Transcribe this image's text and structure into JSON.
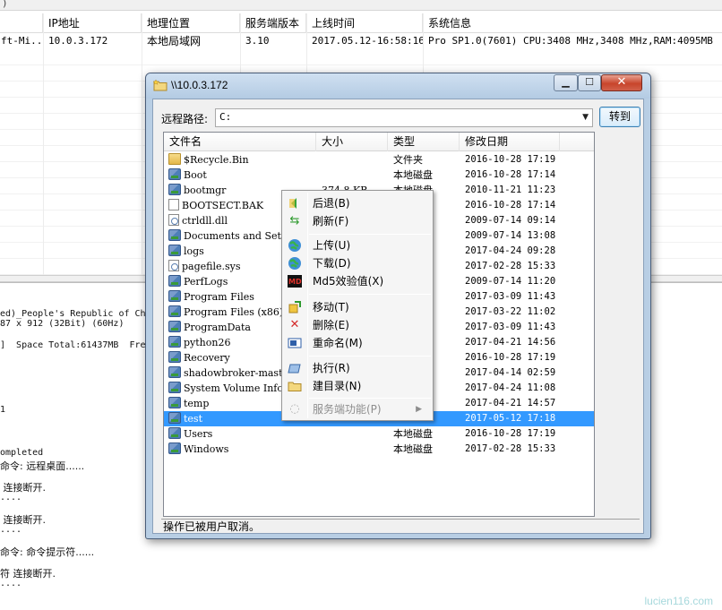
{
  "host_table": {
    "columns": [
      "",
      "IP地址",
      "地理位置",
      "服务端版本",
      "上线时间",
      "系统信息"
    ],
    "row": [
      "ft-Mi...",
      "10.0.3.172",
      "本地局域网",
      "3.10",
      "2017.05.12-16:58:16",
      "Pro SP1.0(7601) CPU:3408 MHz,3408 MHz,RAM:4095MB"
    ]
  },
  "log_lines": [
    "ed)_People's Republic of Ch",
    "87 x 912 (32Bit) (60Hz)",
    "]  Space Total:61437MB  Fre",
    "1",
    "ompleted",
    "命令: 远程桌面......",
    " 连接断开.",
    "....",
    " 连接断开.",
    "....",
    "命令: 命令提示符......",
    "符 连接断开.",
    "...."
  ],
  "dialog": {
    "title": "\\\\10.0.3.172",
    "path_label": "远程路径:",
    "path_value": "C:",
    "goto_label": "转到",
    "status": "操作已被用户取消。",
    "columns": [
      "文件名",
      "大小",
      "类型",
      "修改日期"
    ],
    "files": [
      {
        "icon": "folder",
        "name": "$Recycle.Bin",
        "size": "",
        "type": "文件夹",
        "date": "2016-10-28 17:19"
      },
      {
        "icon": "drive",
        "name": "Boot",
        "size": "",
        "type": "本地磁盘",
        "date": "2016-10-28 17:14"
      },
      {
        "icon": "drive",
        "name": "bootmgr",
        "size": "374.8 KB",
        "type": "本地磁盘",
        "date": "2010-11-21 11:23"
      },
      {
        "icon": "file",
        "name": "BOOTSECT.BAK",
        "size": "",
        "type": "",
        "date": "2016-10-28 17:14"
      },
      {
        "icon": "gear",
        "name": "ctrldll.dll",
        "size": "",
        "type": "...",
        "date": "2009-07-14 09:14"
      },
      {
        "icon": "drive",
        "name": "Documents and Setti",
        "size": "",
        "type": "",
        "date": "2009-07-14 13:08"
      },
      {
        "icon": "drive",
        "name": "logs",
        "size": "",
        "type": "",
        "date": "2017-04-24 09:28"
      },
      {
        "icon": "gear",
        "name": "pagefile.sys",
        "size": "",
        "type": "",
        "date": "2017-02-28 15:33"
      },
      {
        "icon": "drive",
        "name": "PerfLogs",
        "size": "",
        "type": "",
        "date": "2009-07-14 11:20"
      },
      {
        "icon": "drive",
        "name": "Program Files",
        "size": "",
        "type": "",
        "date": "2017-03-09 11:43"
      },
      {
        "icon": "drive",
        "name": "Program Files (x86)",
        "size": "",
        "type": "",
        "date": "2017-03-22 11:02"
      },
      {
        "icon": "drive",
        "name": "ProgramData",
        "size": "",
        "type": "",
        "date": "2017-03-09 11:43"
      },
      {
        "icon": "drive",
        "name": "python26",
        "size": "",
        "type": "",
        "date": "2017-04-21 14:56"
      },
      {
        "icon": "drive",
        "name": "Recovery",
        "size": "",
        "type": "",
        "date": "2016-10-28 17:19"
      },
      {
        "icon": "drive",
        "name": "shadowbroker-master",
        "size": "",
        "type": "",
        "date": "2017-04-14 02:59"
      },
      {
        "icon": "drive",
        "name": "System Volume Infor",
        "size": "",
        "type": "",
        "date": "2017-04-24 11:08"
      },
      {
        "icon": "drive",
        "name": "temp",
        "size": "",
        "type": "",
        "date": "2017-04-21 14:57"
      },
      {
        "icon": "drive",
        "name": "test",
        "size": "",
        "type": "",
        "date": "2017-05-12 17:18",
        "selected": true
      },
      {
        "icon": "drive",
        "name": "Users",
        "size": "",
        "type": "本地磁盘",
        "date": "2016-10-28 17:19"
      },
      {
        "icon": "drive",
        "name": "Windows",
        "size": "",
        "type": "本地磁盘",
        "date": "2017-02-28 15:33"
      }
    ]
  },
  "context_menu": {
    "items": [
      {
        "name": "back",
        "icon": "back-arrow-icon",
        "label": "后退(B)"
      },
      {
        "name": "refresh",
        "icon": "refresh-icon",
        "label": "刷新(F)"
      },
      {
        "name": "upload",
        "icon": "globe-upload-icon",
        "label": "上传(U)"
      },
      {
        "name": "download",
        "icon": "globe-download-icon",
        "label": "下载(D)"
      },
      {
        "name": "md5",
        "icon": "md5-icon",
        "label": "Md5效验值(X)"
      },
      {
        "name": "move",
        "icon": "move-icon",
        "label": "移动(T)"
      },
      {
        "name": "delete",
        "icon": "delete-x-icon",
        "label": "删除(E)"
      },
      {
        "name": "rename",
        "icon": "rename-icon",
        "label": "重命名(M)"
      },
      {
        "name": "execute",
        "icon": "execute-icon",
        "label": "执行(R)"
      },
      {
        "name": "new-folder",
        "icon": "folder-icon",
        "label": "建目录(N)"
      },
      {
        "name": "server-functions",
        "icon": "server-icon",
        "label": "服务端功能(P)",
        "disabled": true,
        "submenu": true
      }
    ]
  },
  "watermark": "lucien116.com",
  "colors": {
    "selection": "#3399ff",
    "window_frame": "#b8cee4",
    "close_button": "#c8452c"
  }
}
